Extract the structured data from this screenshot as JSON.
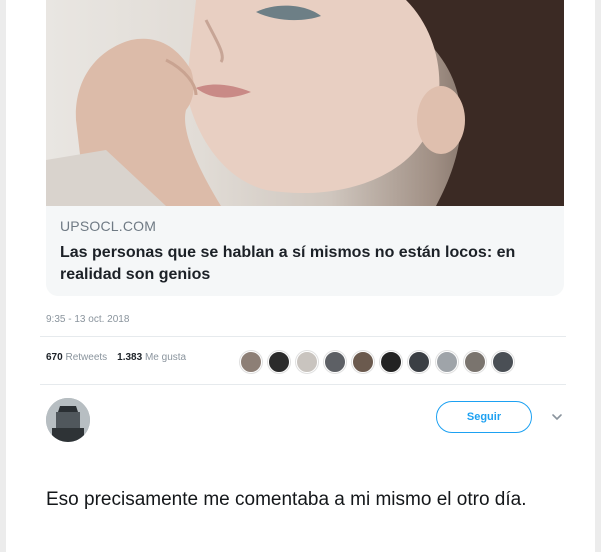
{
  "link_card": {
    "domain": "UPSOCL.COM",
    "headline": "Las personas que se hablan a sí mismos no están locos: en realidad son genios"
  },
  "tweet": {
    "timestamp": "9:35 - 13 oct. 2018",
    "retweets_count": "670",
    "retweets_label": "Retweets",
    "likes_count": "1.383",
    "likes_label": "Me gusta"
  },
  "likers": [
    {
      "color": "#8d7f76"
    },
    {
      "color": "#2b2b2b"
    },
    {
      "color": "#c9c4bf"
    },
    {
      "color": "#5d6065"
    },
    {
      "color": "#6b5a4e"
    },
    {
      "color": "#222222"
    },
    {
      "color": "#3b3f44"
    },
    {
      "color": "#9fa4a9"
    },
    {
      "color": "#7a746e"
    },
    {
      "color": "#4a4f55"
    }
  ],
  "reply_header": {
    "follow_label": "Seguir"
  },
  "reply": {
    "text": "Eso precisamente me comentaba a mi mismo el otro día."
  },
  "colors": {
    "accent": "#1da1f2",
    "muted": "#8a949d"
  }
}
